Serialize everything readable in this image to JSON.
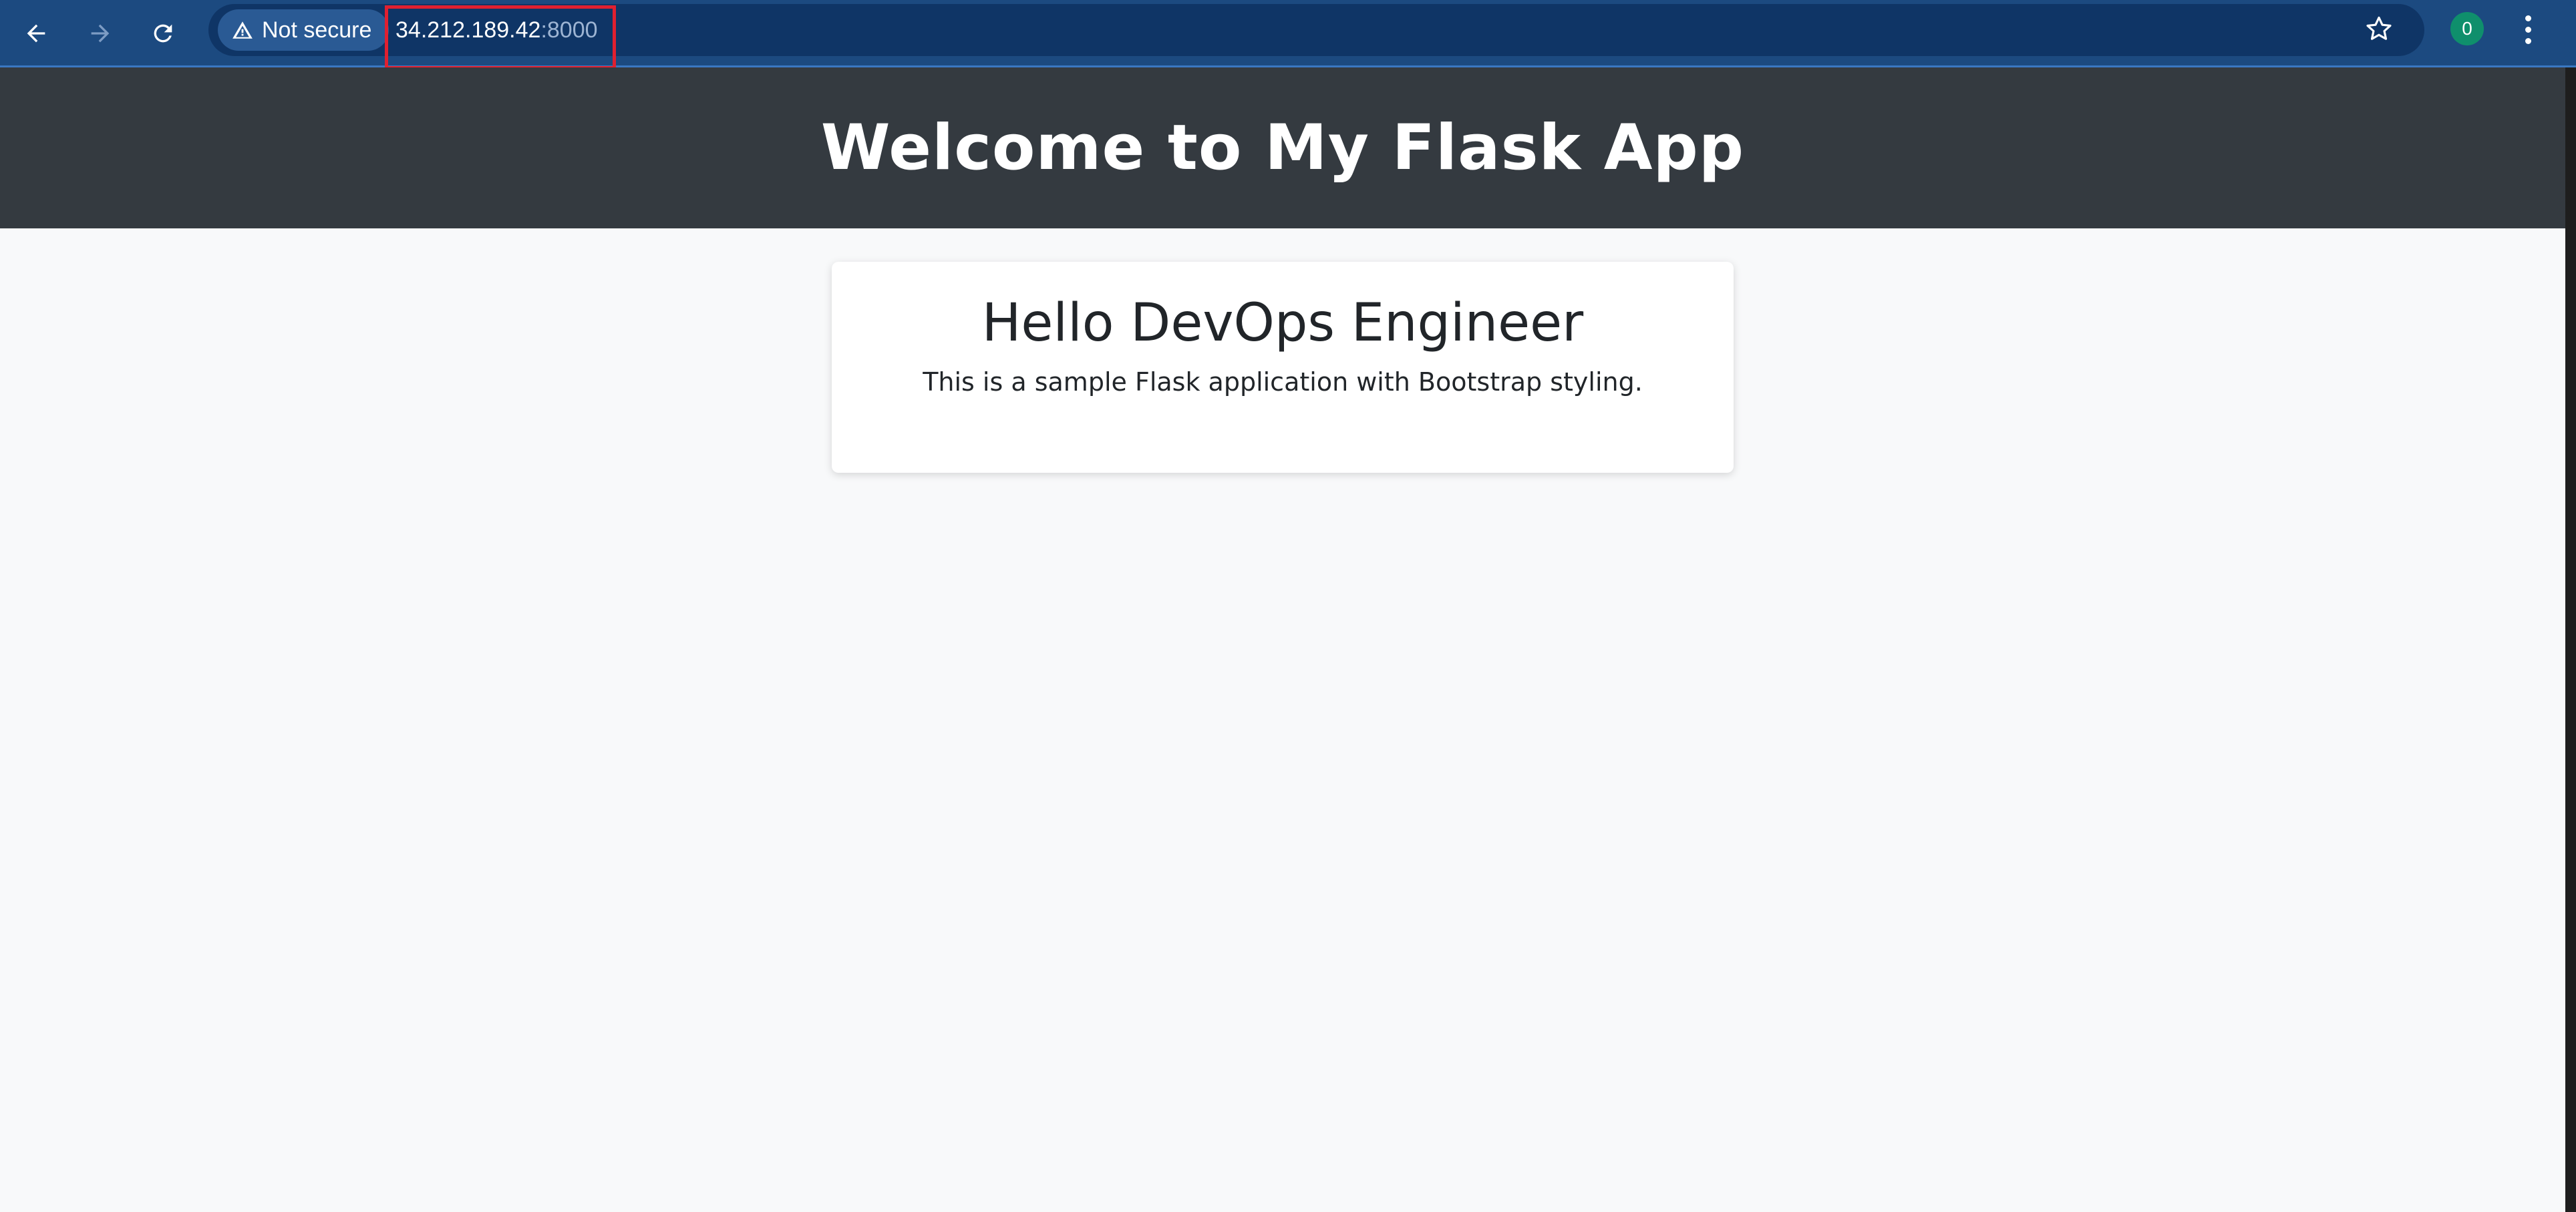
{
  "browser": {
    "security_label": "Not secure",
    "url_host": "34.212.189.42",
    "url_port": ":8000",
    "profile_initial": "0",
    "icons": {
      "back": "arrow-left-icon",
      "forward": "arrow-right-icon",
      "reload": "reload-icon",
      "warning": "warning-triangle-icon",
      "bookmark": "star-icon",
      "menu": "kebab-menu-icon"
    },
    "colors": {
      "toolbar": "#1c4a80",
      "highlight_box": "#e02030",
      "avatar": "#0f8f6c"
    }
  },
  "page": {
    "header_title": "Welcome to My Flask App",
    "card_title": "Hello DevOps Engineer",
    "card_text": "This is a sample Flask application with Bootstrap styling.",
    "colors": {
      "header_bg": "#343a40",
      "body_bg": "#f8f9fa"
    }
  }
}
